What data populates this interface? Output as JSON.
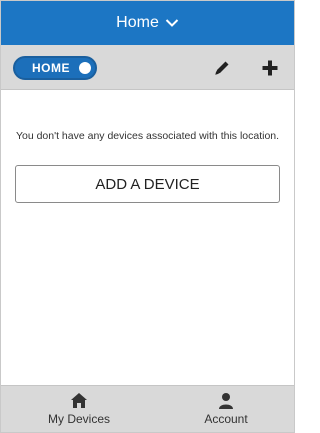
{
  "header": {
    "title": "Home",
    "dropdown_icon": "chevron-down-icon"
  },
  "toolbar": {
    "location_toggle_label": "HOME",
    "edit_icon": "pencil-icon",
    "add_icon": "plus-icon"
  },
  "main": {
    "empty_message": "You don't have any devices associated with this location.",
    "add_device_label": "ADD A DEVICE"
  },
  "bottom_nav": {
    "items": [
      {
        "label": "My Devices",
        "icon": "home-icon"
      },
      {
        "label": "Account",
        "icon": "user-icon"
      }
    ]
  },
  "colors": {
    "primary": "#1c76c4",
    "toolbar_bg": "#d9d9d9"
  }
}
